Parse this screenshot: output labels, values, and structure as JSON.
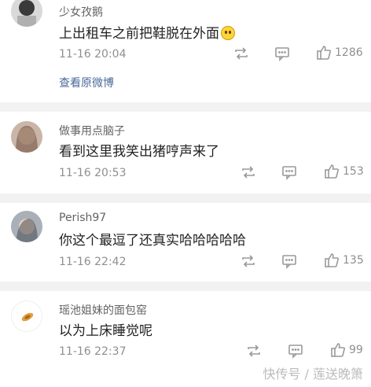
{
  "comments": [
    {
      "username": "少女孜鹅",
      "content": "上出租车之前把鞋脱在外面",
      "content_emoji": "smile-emoji",
      "time": "11-16 20:04",
      "likes": "1286",
      "extra_link": "查看原微博"
    },
    {
      "username": "做事用点脑子",
      "content": "看到这里我笑出猪哼声来了",
      "time": "11-16 20:53",
      "likes": "153"
    },
    {
      "username": "Perish97",
      "content": "你这个最逗了还真实哈哈哈哈哈",
      "time": "11-16 22:42",
      "likes": "135"
    },
    {
      "username": "瑶池姐妹的面包窑",
      "content": "以为上床睡觉呢",
      "time": "11-16 22:37",
      "likes": "99"
    }
  ],
  "watermark": "快传号 / 莲送晚箫",
  "colors": {
    "link": "#4a6a9a",
    "separator": "#f2f2f2",
    "muted_text": "#8f8f8f"
  },
  "icons": [
    "repost-icon",
    "comment-icon",
    "like-icon"
  ]
}
